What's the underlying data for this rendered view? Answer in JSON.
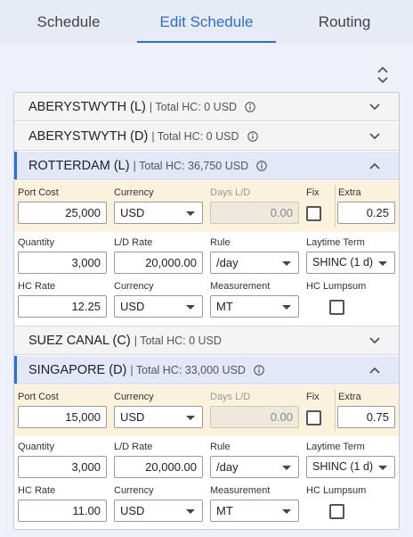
{
  "tabs": [
    {
      "label": "Schedule"
    },
    {
      "label": "Edit Schedule"
    },
    {
      "label": "Routing"
    }
  ],
  "ports": [
    {
      "name": "ABERYSTWYTH (L)",
      "total": "| Total HC: 0 USD",
      "info_icon": "info-icon",
      "expanded": false
    },
    {
      "name": "ABERYSTWYTH (D)",
      "total": "| Total HC: 0 USD",
      "info_icon": "info-icon",
      "expanded": false
    },
    {
      "name": "ROTTERDAM (L)",
      "total": "| Total HC: 36,750 USD",
      "info_icon": "info-icon",
      "expanded": true,
      "port_cost_label": "Port Cost",
      "port_cost": "25,000",
      "currency_label": "Currency",
      "currency": "USD",
      "days_label": "Days L/D",
      "days": "0.00",
      "fix_label": "Fix",
      "extra_label": "Extra",
      "extra": "0.25",
      "quantity_label": "Quantity",
      "quantity": "3,000",
      "ld_rate_label": "L/D Rate",
      "ld_rate": "20,000.00",
      "rule_label": "Rule",
      "rule": "/day",
      "laytime_label": "Laytime Term",
      "laytime": "SHINC (1 d)",
      "hc_rate_label": "HC Rate",
      "hc_rate": "12.25",
      "hc_currency_label": "Currency",
      "hc_currency": "USD",
      "measurement_label": "Measurement",
      "measurement": "MT",
      "hc_lumpsum_label": "HC Lumpsum"
    },
    {
      "name": "SUEZ CANAL (C)",
      "total": "| Total HC: 0 USD",
      "info_icon": "",
      "expanded": false
    },
    {
      "name": "SINGAPORE (D)",
      "total": "| Total HC: 33,000 USD",
      "info_icon": "info-icon",
      "expanded": true,
      "port_cost_label": "Port Cost",
      "port_cost": "15,000",
      "currency_label": "Currency",
      "currency": "USD",
      "days_label": "Days L/D",
      "days": "0.00",
      "fix_label": "Fix",
      "extra_label": "Extra",
      "extra": "0.75",
      "quantity_label": "Quantity",
      "quantity": "3,000",
      "ld_rate_label": "L/D Rate",
      "ld_rate": "20,000.00",
      "rule_label": "Rule",
      "rule": "/day",
      "laytime_label": "Laytime Term",
      "laytime": "SHINC (1 d)",
      "hc_rate_label": "HC Rate",
      "hc_rate": "11.00",
      "hc_currency_label": "Currency",
      "hc_currency": "USD",
      "measurement_label": "Measurement",
      "measurement": "MT",
      "hc_lumpsum_label": "HC Lumpsum"
    }
  ],
  "colors": {
    "accent": "#2a6fd4",
    "cost_band": "#fbf2dd",
    "expanded_header": "#e2e8f7"
  }
}
